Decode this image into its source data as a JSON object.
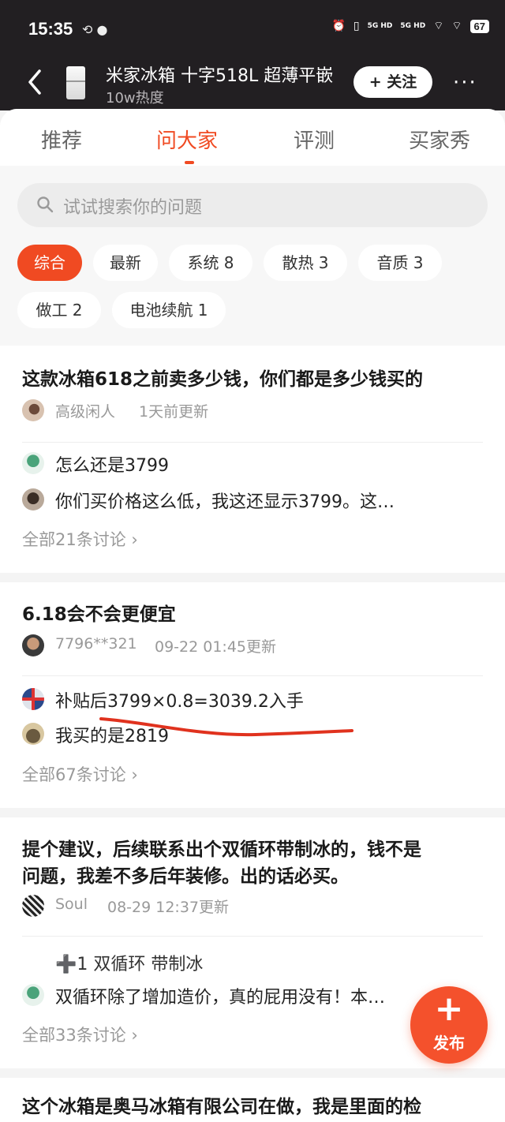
{
  "status_bar": {
    "time": "15:35",
    "battery": "67",
    "net1": "5G HD",
    "net2": "5G HD"
  },
  "header": {
    "title": "米家冰箱 十字518L 超薄平嵌",
    "heat": "10w热度",
    "follow": "+ 关注",
    "more": "···"
  },
  "tabs": [
    {
      "label": "推荐",
      "active": false
    },
    {
      "label": "问大家",
      "active": true
    },
    {
      "label": "评测",
      "active": false
    },
    {
      "label": "买家秀",
      "active": false
    }
  ],
  "search": {
    "placeholder": "试试搜索你的问题"
  },
  "filters": [
    {
      "label": "综合",
      "active": true
    },
    {
      "label": "最新",
      "active": false
    },
    {
      "label": "系统  8",
      "active": false
    },
    {
      "label": "散热  3",
      "active": false
    },
    {
      "label": "音质  3",
      "active": false
    },
    {
      "label": "做工  2",
      "active": false
    },
    {
      "label": "电池续航  1",
      "active": false
    }
  ],
  "questions": [
    {
      "title": "这款冰箱618之前卖多少钱，你们都是多少钱买的",
      "author": "高级闲人",
      "time": "1天前更新",
      "answers": [
        "怎么还是3799",
        "你们买价格这么低，我这还显示3799。这…"
      ],
      "all_link": "全部21条讨论 ›"
    },
    {
      "title": "6.18会不会更便宜",
      "author": "7796**321",
      "time": "09-22 01:45更新",
      "answers": [
        "补贴后3799×0.8=3039.2入手",
        "我买的是2819"
      ],
      "all_link": "全部67条讨论 ›"
    },
    {
      "title_line1": "提个建议，后续联系出个双循环带制冰的，钱不是",
      "title_line2": "问题，我差不多后年装修。出的话必买。",
      "author": "Soul",
      "time": "08-29 12:37更新",
      "tags": "➕1  双循环  带制冰",
      "answers": [
        "双循环除了增加造价，真的屁用没有！本…"
      ],
      "all_link": "全部33条讨论 ›"
    },
    {
      "title": "这个冰箱是奥马冰箱有限公司在做，我是里面的检"
    }
  ],
  "fab": {
    "label": "发布",
    "plus": "+"
  },
  "colors": {
    "accent": "#f04a22",
    "header_bg": "#221f22",
    "underline": "#e0321e"
  }
}
